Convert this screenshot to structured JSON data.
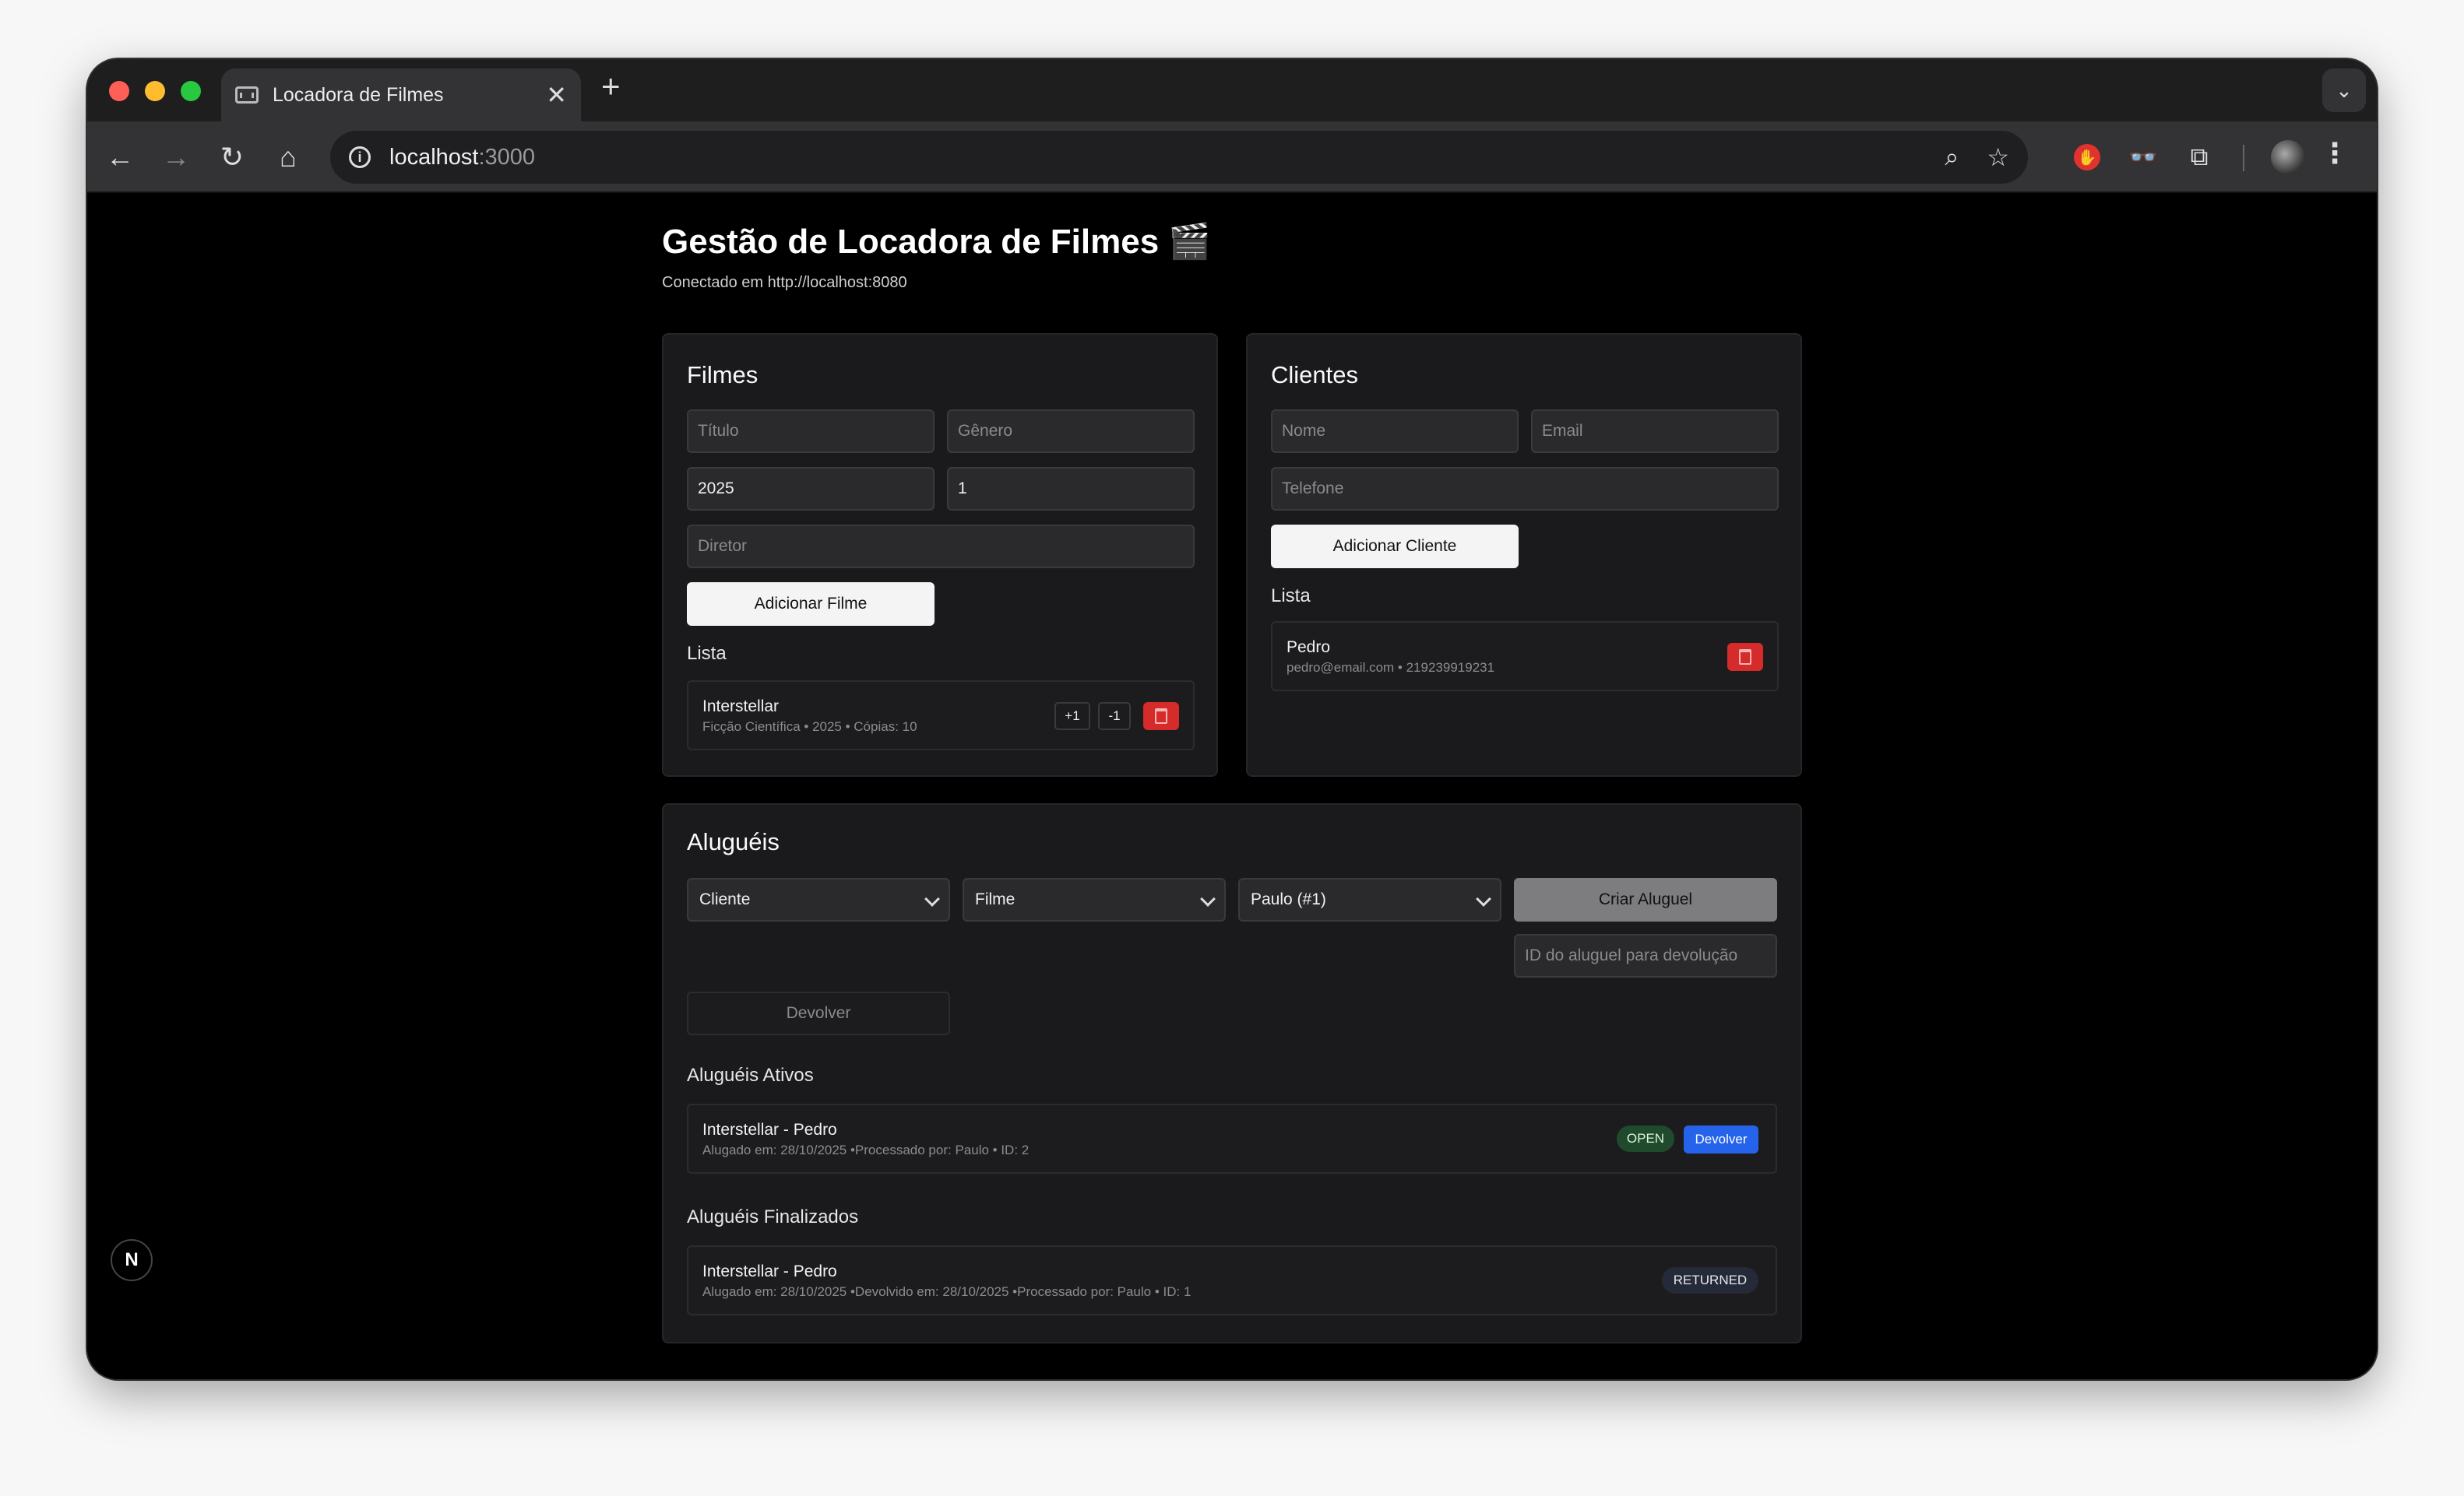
{
  "browser": {
    "tab_title": "Locadora de Filmes",
    "tab_close": "✕",
    "new_tab": "+",
    "url_host": "localhost",
    "url_port": ":3000"
  },
  "header": {
    "title": "Gestão de Locadora de Filmes 🎬",
    "connection": "Conectado em http://localhost:8080"
  },
  "filmes": {
    "title": "Filmes",
    "titulo_placeholder": "Título",
    "genero_placeholder": "Gênero",
    "ano_value": "2025",
    "copias_value": "1",
    "diretor_placeholder": "Diretor",
    "add_button": "Adicionar Filme",
    "list_title": "Lista",
    "items": [
      {
        "title": "Interstellar",
        "meta": "Ficção Científica • 2025 • Cópias: 10",
        "plus": "+1",
        "minus": "-1"
      }
    ]
  },
  "clientes": {
    "title": "Clientes",
    "nome_placeholder": "Nome",
    "email_placeholder": "Email",
    "telefone_placeholder": "Telefone",
    "add_button": "Adicionar Cliente",
    "list_title": "Lista",
    "items": [
      {
        "name": "Pedro",
        "meta": "pedro@email.com • 219239919231"
      }
    ]
  },
  "alugueis": {
    "title": "Aluguéis",
    "cliente_select": "Cliente",
    "filme_select": "Filme",
    "funcionario_select": "Paulo (#1)",
    "criar_button": "Criar Aluguel",
    "devolucao_placeholder": "ID do aluguel para devolução",
    "devolver_button": "Devolver",
    "ativos_title": "Aluguéis Ativos",
    "ativos": [
      {
        "title": "Interstellar - Pedro",
        "meta": "Alugado em: 28/10/2025 •Processado por: Paulo • ID: 2",
        "status": "OPEN",
        "action": "Devolver"
      }
    ],
    "finalizados_title": "Aluguéis Finalizados",
    "finalizados": [
      {
        "title": "Interstellar - Pedro",
        "meta": "Alugado em: 28/10/2025 •Devolvido em: 28/10/2025 •Processado por: Paulo • ID: 1",
        "status": "RETURNED"
      }
    ]
  },
  "dev_indicator": "N"
}
